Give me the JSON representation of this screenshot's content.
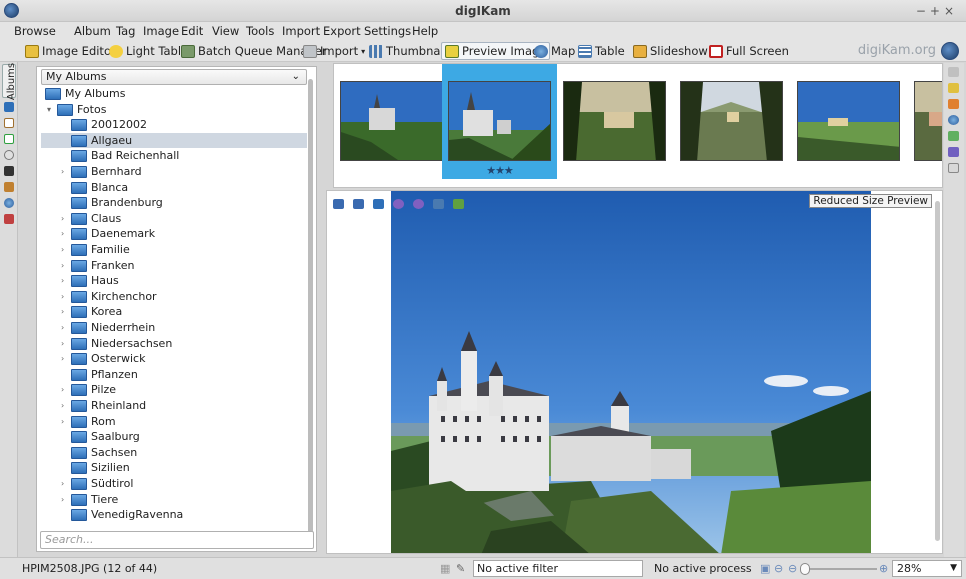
{
  "window": {
    "title": "digIKam"
  },
  "menubar": [
    "Browse",
    "Album",
    "Tag",
    "Image",
    "Edit",
    "View",
    "Tools",
    "Import",
    "Export",
    "Settings",
    "Help"
  ],
  "toolbar": {
    "image_editor": "Image Editor",
    "light_table": "Light Table",
    "batch_queue_manager": "Batch Queue Manager",
    "import": "Import",
    "thumbnails": "Thumbnails",
    "preview_image": "Preview Image",
    "map": "Map",
    "table": "Table",
    "slideshow": "Slideshow",
    "full_screen": "Full Screen",
    "brand": "digiKam.org",
    "active_view": "preview_image"
  },
  "left_tabs": {
    "albums": "Albums"
  },
  "albums": {
    "selector": "My Albums",
    "root": "My Albums",
    "parent": "Fotos",
    "selected": "Allgaeu",
    "items": [
      {
        "name": "20012002",
        "expandable": false
      },
      {
        "name": "Allgaeu",
        "expandable": false
      },
      {
        "name": "Bad Reichenhall",
        "expandable": false
      },
      {
        "name": "Bernhard",
        "expandable": true
      },
      {
        "name": "Blanca",
        "expandable": false
      },
      {
        "name": "Brandenburg",
        "expandable": false
      },
      {
        "name": "Claus",
        "expandable": true
      },
      {
        "name": "Daenemark",
        "expandable": true
      },
      {
        "name": "Familie",
        "expandable": true
      },
      {
        "name": "Franken",
        "expandable": true
      },
      {
        "name": "Haus",
        "expandable": true
      },
      {
        "name": "Kirchenchor",
        "expandable": true
      },
      {
        "name": "Korea",
        "expandable": true
      },
      {
        "name": "Niederrhein",
        "expandable": true
      },
      {
        "name": "Niedersachsen",
        "expandable": true
      },
      {
        "name": "Osterwick",
        "expandable": true
      },
      {
        "name": "Pflanzen",
        "expandable": false
      },
      {
        "name": "Pilze",
        "expandable": true
      },
      {
        "name": "Rheinland",
        "expandable": true
      },
      {
        "name": "Rom",
        "expandable": true
      },
      {
        "name": "Saalburg",
        "expandable": false
      },
      {
        "name": "Sachsen",
        "expandable": false
      },
      {
        "name": "Sizilien",
        "expandable": false
      },
      {
        "name": "Südtirol",
        "expandable": true
      },
      {
        "name": "Tiere",
        "expandable": true
      },
      {
        "name": "VenedigRavenna",
        "expandable": false
      }
    ],
    "search_placeholder": "Search..."
  },
  "thumbnails": {
    "selected_index": 1,
    "selected_rating": "★★★"
  },
  "preview": {
    "badge": "Reduced Size Preview"
  },
  "statusbar": {
    "file_info": "HPIM2508.JPG (12 of 44)",
    "filter": "No active filter",
    "process": "No active process",
    "zoom": "28%"
  },
  "colors": {
    "selection": "#3da9e4",
    "tree_selection": "#cfd7e1",
    "folder": "#2e6fb8",
    "sky": "#2f72c4"
  }
}
